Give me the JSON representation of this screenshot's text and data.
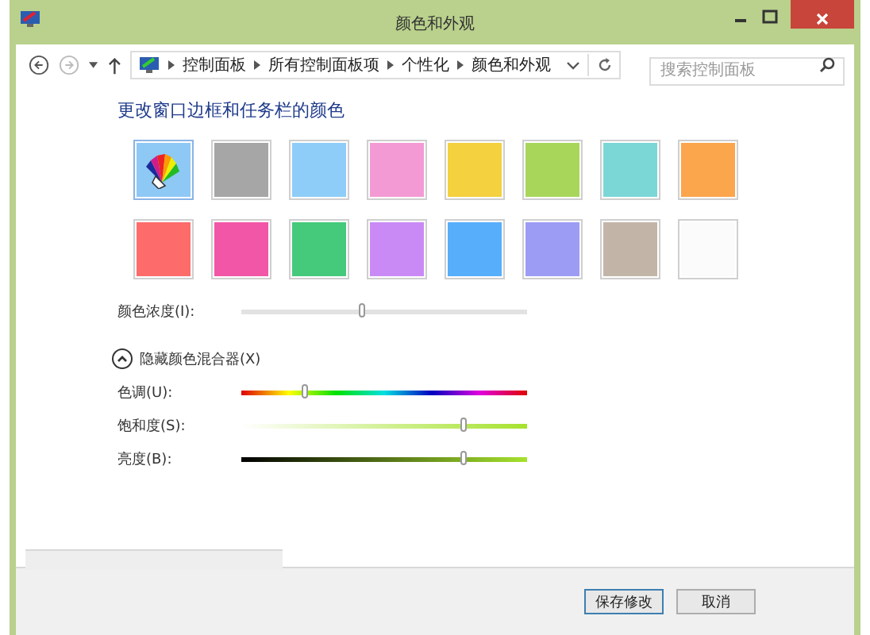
{
  "window": {
    "title": "颜色和外观"
  },
  "address": {
    "crumbs": [
      "控制面板",
      "所有控制面板项",
      "个性化",
      "颜色和外观"
    ],
    "search_placeholder": "搜索控制面板"
  },
  "heading": "更改窗口边框和任务栏的颜色",
  "swatches": [
    {
      "kind": "custom",
      "color": "#8ec8f5",
      "selected": true
    },
    {
      "kind": "solid",
      "color": "#a6a6a6",
      "selected": false
    },
    {
      "kind": "solid",
      "color": "#8ecdf7",
      "selected": false
    },
    {
      "kind": "solid",
      "color": "#f39ad4",
      "selected": false
    },
    {
      "kind": "solid",
      "color": "#f3d13f",
      "selected": false
    },
    {
      "kind": "solid",
      "color": "#a8d65a",
      "selected": false
    },
    {
      "kind": "solid",
      "color": "#7ad7d6",
      "selected": false
    },
    {
      "kind": "solid",
      "color": "#fba54c",
      "selected": false
    },
    {
      "kind": "solid",
      "color": "#fe6b6b",
      "selected": false
    },
    {
      "kind": "solid",
      "color": "#f256a6",
      "selected": false
    },
    {
      "kind": "solid",
      "color": "#45c97a",
      "selected": false
    },
    {
      "kind": "solid",
      "color": "#c98af5",
      "selected": false
    },
    {
      "kind": "solid",
      "color": "#57aefb",
      "selected": false
    },
    {
      "kind": "solid",
      "color": "#9c9cf5",
      "selected": false
    },
    {
      "kind": "solid",
      "color": "#c2b5a8",
      "selected": false
    },
    {
      "kind": "solid",
      "color": "#fbfbfb",
      "selected": false
    }
  ],
  "intensity": {
    "label": "颜色浓度(I):",
    "level": 0.42
  },
  "mixer_toggle": {
    "label": "隐藏颜色混合器(X)",
    "expanded": true
  },
  "mixer": [
    {
      "kind": "hue",
      "label": "色调(U):",
      "level": 0.22
    },
    {
      "kind": "saturation",
      "label": "饱和度(S):",
      "level": 0.78
    },
    {
      "kind": "brightness",
      "label": "亮度(B):",
      "level": 0.78
    }
  ],
  "buttons": [
    {
      "label": "保存修改",
      "default": true
    },
    {
      "label": "取消",
      "default": false
    }
  ]
}
